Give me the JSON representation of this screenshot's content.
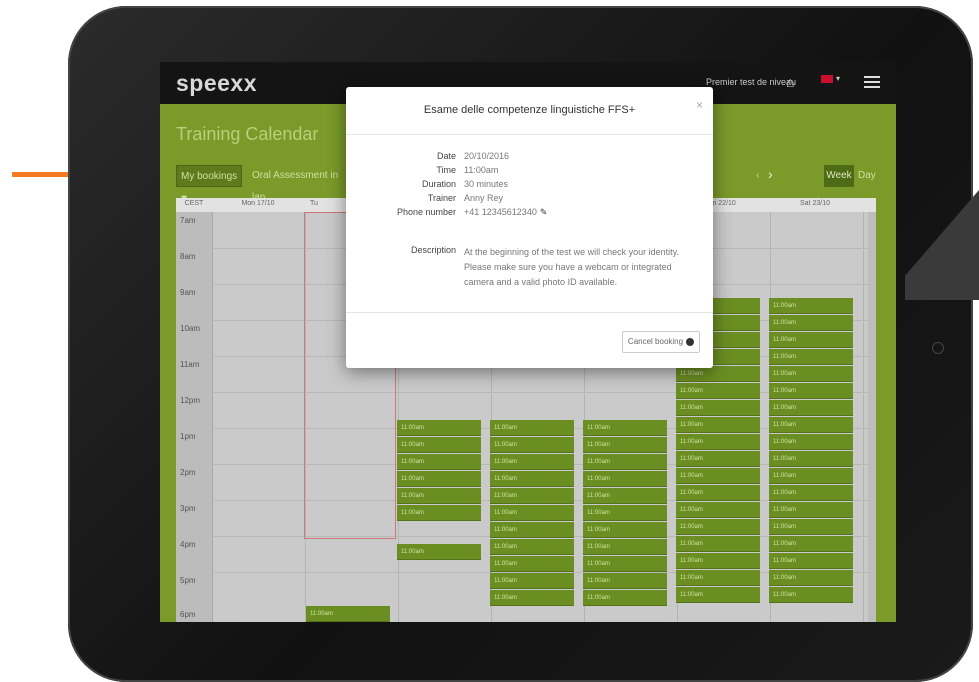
{
  "app": {
    "brand": "speexx",
    "level_test_link": "Premier test de niveau",
    "page_title": "Training Calendar"
  },
  "toolbar": {
    "my_bookings": "My bookings",
    "filter": "Oral Assessment in lan",
    "week": "Week",
    "day": "Day"
  },
  "calendar": {
    "time_header": "CEST",
    "day_headers": [
      "Mon 17/10",
      "Tu",
      "",
      "",
      "",
      "Fri 22/10",
      "Sat 23/10"
    ],
    "hours": [
      "7am",
      "8am",
      "9am",
      "10am",
      "11am",
      "12pm",
      "1pm",
      "2pm",
      "3pm",
      "4pm",
      "5pm",
      "6pm"
    ],
    "slot_label": "11:00am"
  },
  "modal": {
    "title": "Esame delle competenze linguistiche FFS+",
    "fields": [
      {
        "label": "Date",
        "value": "20/10/2016"
      },
      {
        "label": "Time",
        "value": "11:00am"
      },
      {
        "label": "Duration",
        "value": "30 minutes"
      },
      {
        "label": "Trainer",
        "value": "Anny Rey"
      },
      {
        "label": "Phone number",
        "value": "+41 12345612340"
      }
    ],
    "description_label": "Description",
    "description": "At the beginning of the test we will check your identity. Please make sure you have a webcam or integrated camera and a valid photo ID available.",
    "cancel_label": "Cancel booking"
  },
  "icons": {
    "lock": "lock-icon",
    "home": "home-icon",
    "flag": "flag-icon",
    "menu": "menu-icon",
    "close": "close-icon",
    "edit": "pencil-icon",
    "cancel": "cancel-icon",
    "arrow": "arrow-right-icon"
  },
  "colors": {
    "brand_green": "#7a9a2a",
    "slot_green": "#6b8e23",
    "arrow_orange": "#f47b20",
    "logo_x": "#e03a1e"
  }
}
